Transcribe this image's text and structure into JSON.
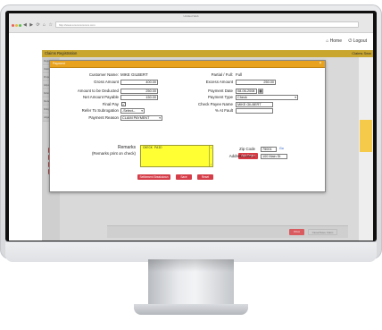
{
  "browser": {
    "window_title": "Untitled Web",
    "url": "http://www.xxxxxxxxxxxxx.com"
  },
  "app": {
    "home_label": "Home",
    "logout_label": "Logout",
    "page_title": "Claims Registration",
    "page_title_right": "Claims Sear",
    "left_nav": [
      "Registra",
      "Claim Cr",
      "Property",
      "Adjuster",
      "Reference",
      "Review",
      "Policy T",
      "Litigat"
    ],
    "print_label": "Print",
    "close_label": "Close/Save Claim"
  },
  "modal": {
    "header": "Payment",
    "close_glyph": "×",
    "customer_name_label": "Customer Name:",
    "customer_name": "MIKE GILBERT",
    "partial_full_label": "Partial / Full:",
    "partial_full": "Full",
    "gross_amount_label": "Gross Amount",
    "gross_amount": "400.00",
    "excess_amount_label": "Excess Amount",
    "excess_amount": "250.00",
    "deducted_label": "Amount to be Deducted",
    "deducted": "250.00",
    "payment_date_label": "Payment Date",
    "payment_date": "08-06-2008",
    "net_payable_label": "Net Amount Payable",
    "net_payable": "150.00",
    "payment_type_label": "Payment Type",
    "payment_type": "Check",
    "final_pay_label": "Final Pay",
    "final_pay_checked": "✓",
    "check_payee_label": "Check Payee Name",
    "check_payee": "MIKE GILBERT",
    "refer_label": "Refer To Subrogation",
    "refer_value": "-Select--",
    "at_fault_label": "% At Fault",
    "payment_reason_label": "Payment Reason",
    "payment_reason": "CLAIM PAYMENT",
    "add_payee_label": "Add Payee",
    "remarks_label": "Remarks",
    "remarks_sublabel": "(Remarks print on check)",
    "remarks_text": "CHECK PAID",
    "zip_label": "Zip Code",
    "zip_value": "75001",
    "zip_link": "Go",
    "address_label": "Address Line 1",
    "address_value": "100 Main St",
    "settlement_label": "Settlement Breakdown",
    "save_label": "Save",
    "reset_label": "Reset"
  }
}
